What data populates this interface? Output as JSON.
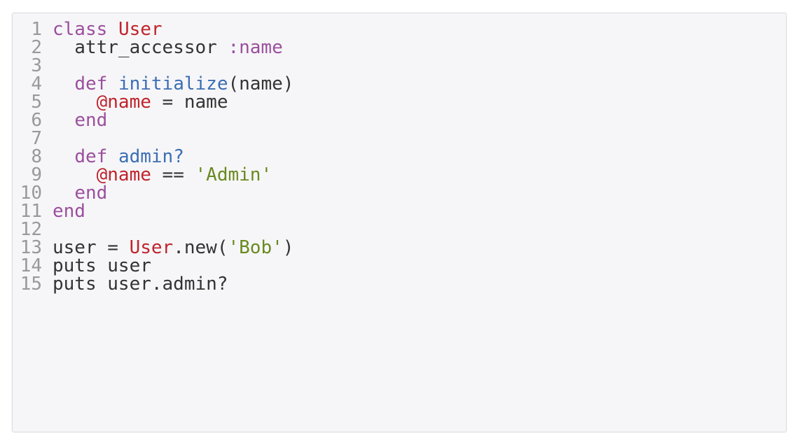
{
  "editor": {
    "language": "ruby",
    "colors": {
      "keyword": "#9b4f9e",
      "constant": "#c0242c",
      "symbol": "#9b4f9e",
      "function": "#3c6eb4",
      "ivar": "#c0242c",
      "string": "#6a8a1f",
      "plain": "#333333",
      "line_number": "#999999",
      "background": "#f6f6f8"
    },
    "lines": [
      {
        "number": "1",
        "tokens": [
          {
            "t": "class",
            "k": "kw"
          },
          {
            "t": " ",
            "k": "plain"
          },
          {
            "t": "User",
            "k": "const"
          }
        ]
      },
      {
        "number": "2",
        "tokens": [
          {
            "t": "  attr_accessor ",
            "k": "plain"
          },
          {
            "t": ":name",
            "k": "sym"
          }
        ]
      },
      {
        "number": "3",
        "tokens": []
      },
      {
        "number": "4",
        "tokens": [
          {
            "t": "  ",
            "k": "plain"
          },
          {
            "t": "def",
            "k": "kw"
          },
          {
            "t": " ",
            "k": "plain"
          },
          {
            "t": "initialize",
            "k": "fn"
          },
          {
            "t": "(name)",
            "k": "plain"
          }
        ]
      },
      {
        "number": "5",
        "tokens": [
          {
            "t": "    ",
            "k": "plain"
          },
          {
            "t": "@name",
            "k": "ivar"
          },
          {
            "t": " = name",
            "k": "plain"
          }
        ]
      },
      {
        "number": "6",
        "tokens": [
          {
            "t": "  ",
            "k": "plain"
          },
          {
            "t": "end",
            "k": "kw"
          }
        ]
      },
      {
        "number": "7",
        "tokens": []
      },
      {
        "number": "8",
        "tokens": [
          {
            "t": "  ",
            "k": "plain"
          },
          {
            "t": "def",
            "k": "kw"
          },
          {
            "t": " ",
            "k": "plain"
          },
          {
            "t": "admin?",
            "k": "fn"
          }
        ]
      },
      {
        "number": "9",
        "tokens": [
          {
            "t": "    ",
            "k": "plain"
          },
          {
            "t": "@name",
            "k": "ivar"
          },
          {
            "t": " == ",
            "k": "plain"
          },
          {
            "t": "'Admin'",
            "k": "str"
          }
        ]
      },
      {
        "number": "10",
        "tokens": [
          {
            "t": "  ",
            "k": "plain"
          },
          {
            "t": "end",
            "k": "kw"
          }
        ]
      },
      {
        "number": "11",
        "tokens": [
          {
            "t": "end",
            "k": "kw"
          }
        ]
      },
      {
        "number": "12",
        "tokens": []
      },
      {
        "number": "13",
        "tokens": [
          {
            "t": "user = ",
            "k": "plain"
          },
          {
            "t": "User",
            "k": "const"
          },
          {
            "t": ".new(",
            "k": "plain"
          },
          {
            "t": "'Bob'",
            "k": "str"
          },
          {
            "t": ")",
            "k": "plain"
          }
        ]
      },
      {
        "number": "14",
        "tokens": [
          {
            "t": "puts user",
            "k": "plain"
          }
        ]
      },
      {
        "number": "15",
        "tokens": [
          {
            "t": "puts user.admin?",
            "k": "plain"
          }
        ]
      }
    ]
  }
}
